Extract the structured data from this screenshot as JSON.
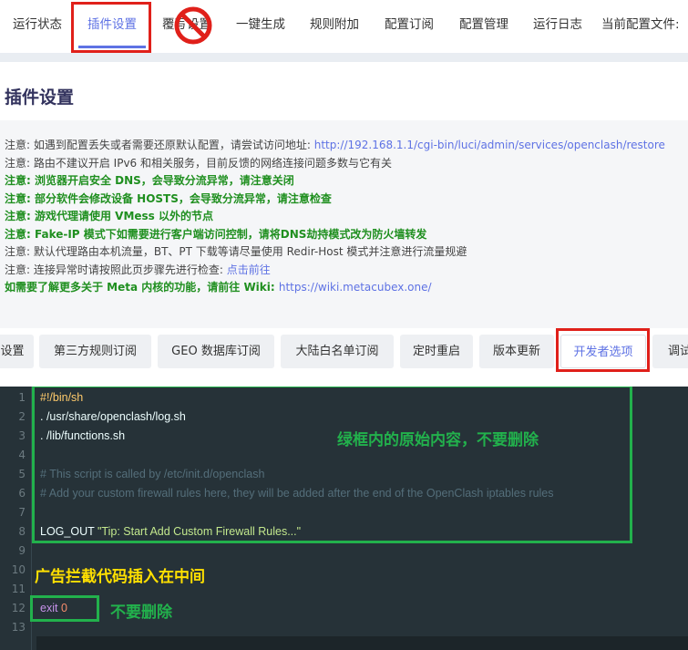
{
  "top_nav": {
    "tabs": [
      {
        "label": "运行状态",
        "active": false
      },
      {
        "label": "插件设置",
        "active": true
      },
      {
        "label": "覆写设置",
        "active": false
      },
      {
        "label": "一键生成",
        "active": false
      },
      {
        "label": "规则附加",
        "active": false
      },
      {
        "label": "配置订阅",
        "active": false
      },
      {
        "label": "配置管理",
        "active": false
      },
      {
        "label": "运行日志",
        "active": false
      },
      {
        "label": "当前配置文件:",
        "active": false
      }
    ]
  },
  "page": {
    "title": "插件设置"
  },
  "notices": [
    {
      "text": "注意: 如遇到配置丢失或者需要还原默认配置，请尝试访问地址: ",
      "link": "http://192.168.1.1/cgi-bin/luci/admin/services/openclash/restore",
      "bold": false
    },
    {
      "text": "注意: 路由不建议开启 IPv6 和相关服务，目前反馈的网络连接问题多数与它有关",
      "link": "",
      "bold": false
    },
    {
      "text": "注意: 浏览器开启安全 DNS，会导致分流异常，请注意关闭",
      "link": "",
      "bold": true
    },
    {
      "text": "注意: 部分软件会修改设备 HOSTS，会导致分流异常，请注意检查",
      "link": "",
      "bold": true
    },
    {
      "text": "注意: 游戏代理请使用 VMess 以外的节点",
      "link": "",
      "bold": true
    },
    {
      "text": "注意: Fake-IP 模式下如需要进行客户端访问控制，请将DNS劫持模式改为防火墙转发",
      "link": "",
      "bold": true
    },
    {
      "text": "注意: 默认代理路由本机流量，BT、PT 下载等请尽量使用 Redir-Host 模式并注意进行流量规避",
      "link": "",
      "bold": false
    },
    {
      "text": "注意: 连接异常时请按照此页步骤先进行检查: ",
      "link": "点击前往",
      "bold": false
    },
    {
      "text": "如需要了解更多关于 Meta 内核的功能，请前往 Wiki: ",
      "link": "https://wiki.metacubex.one/",
      "bold": true
    }
  ],
  "sub_tabs": [
    {
      "label": "设置",
      "active": false
    },
    {
      "label": "第三方规则订阅",
      "active": false
    },
    {
      "label": "GEO 数据库订阅",
      "active": false
    },
    {
      "label": "大陆白名单订阅",
      "active": false
    },
    {
      "label": "定时重启",
      "active": false
    },
    {
      "label": "版本更新",
      "active": false
    },
    {
      "label": "开发者选项",
      "active": true
    },
    {
      "label": "调试",
      "active": false
    }
  ],
  "editor": {
    "line_numbers": [
      "1",
      "2",
      "3",
      "4",
      "5",
      "6",
      "7",
      "8",
      "9",
      "10",
      "11",
      "12",
      "13"
    ],
    "lines": {
      "l1": "#!/bin/sh",
      "l2": ". /usr/share/openclash/log.sh",
      "l3": ". /lib/functions.sh",
      "l5": "# This script is called by /etc/init.d/openclash",
      "l6": "# Add your custom firewall rules here, they will be added after the end of the OpenClash iptables rules",
      "l8_cmd": "LOG_OUT ",
      "l8_str": "\"Tip: Start Add Custom Firewall Rules...\"",
      "l12_kw": "exit",
      "l12_num": "0"
    }
  },
  "annotations": {
    "green_box_note": "绿框内的原始内容，不要删除",
    "insert_note": "广告拦截代码插入在中间",
    "exit_note": "不要删除"
  },
  "colors": {
    "accent": "#5e72e4",
    "highlight_red": "#e0201a",
    "highlight_green": "#22b14c",
    "annotation_yellow": "#ffe000",
    "editor_bg": "#263238"
  }
}
